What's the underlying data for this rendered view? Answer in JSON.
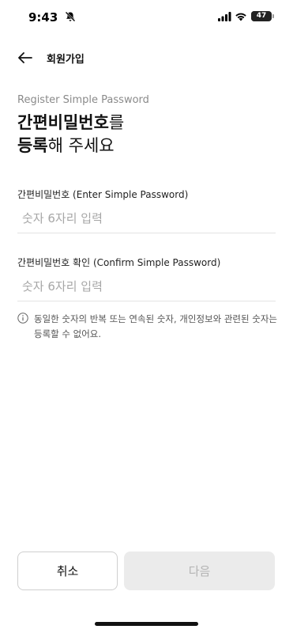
{
  "status_bar": {
    "time": "9:43",
    "battery_level": "47",
    "battery_fraction": 0.47
  },
  "header": {
    "title": "회원가입"
  },
  "main": {
    "subtitle": "Register Simple Password",
    "heading_bold_1": "간편비밀번호",
    "heading_normal_1": "를",
    "heading_bold_2": "등록",
    "heading_normal_2": "해 주세요"
  },
  "form": {
    "password_label": "간편비밀번호 (Enter Simple Password)",
    "password_placeholder": "숫자 6자리 입력",
    "confirm_label": "간편비밀번호 확인 (Confirm Simple Password)",
    "confirm_placeholder": "숫자 6자리 입력"
  },
  "notice": {
    "text": "동일한 숫자의 반복 또는 연속된 숫자, 개인정보와 관련된 숫자는 등록할 수 없어요."
  },
  "buttons": {
    "cancel_label": "취소",
    "next_label": "다음"
  },
  "icons": {
    "back": "arrow-left-icon",
    "info": "info-circle-icon",
    "bell_off": "bell-off-icon",
    "signal": "cellular-signal-icon",
    "wifi": "wifi-icon",
    "battery": "battery-icon"
  },
  "colors": {
    "text_primary": "#111111",
    "text_secondary": "#8a8a8a",
    "disabled_bg": "#ebebeb",
    "disabled_text": "#b3b3b3",
    "divider": "#e3e3e3"
  }
}
